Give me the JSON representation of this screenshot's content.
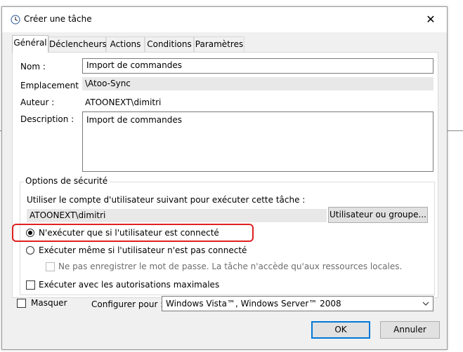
{
  "window": {
    "title": "Créer une tâche",
    "close_glyph": "✕"
  },
  "tabs": [
    {
      "label": "Général",
      "active": true
    },
    {
      "label": "Déclencheurs",
      "active": false
    },
    {
      "label": "Actions",
      "active": false
    },
    {
      "label": "Conditions",
      "active": false
    },
    {
      "label": "Paramètres",
      "active": false
    }
  ],
  "general": {
    "name_label": "Nom :",
    "name_value": "Import de commandes",
    "location_label": "Emplacement :",
    "location_value": "\\Atoo-Sync",
    "author_label": "Auteur :",
    "author_value": "ATOONEXT\\dimitri",
    "description_label": "Description :",
    "description_value": "Import de commandes"
  },
  "security": {
    "group_title": "Options de sécurité",
    "account_prompt": "Utiliser le compte d'utilisateur suivant pour exécuter cette tâche :",
    "account_value": "ATOONEXT\\dimitri",
    "user_group_button": "Utilisateur ou groupe...",
    "radio_logged_on": {
      "label": "N'exécuter que si l'utilisateur est connecté",
      "selected": true
    },
    "radio_whether_logged": {
      "label": "Exécuter même si l'utilisateur n'est pas connecté",
      "selected": false
    },
    "no_store_password": {
      "label": "Ne pas enregistrer le mot de passe. La tâche n'accède qu'aux ressources locales.",
      "checked": false,
      "enabled": false
    },
    "highest_privileges": {
      "label": "Exécuter avec les autorisations maximales",
      "checked": false
    }
  },
  "bottom": {
    "hidden_label": "Masquer",
    "hidden_checked": false,
    "configure_label": "Configurer pour :",
    "configure_value": "Windows Vista™, Windows Server™ 2008"
  },
  "buttons": {
    "ok": "OK",
    "cancel": "Annuler"
  },
  "colors": {
    "highlight": "#e02020",
    "default_button_border": "#0078d7",
    "dialog_background": "#f0f0f0"
  },
  "icons": {
    "title_icon": "clock-icon",
    "combo_arrow": "chevron-down-icon"
  }
}
